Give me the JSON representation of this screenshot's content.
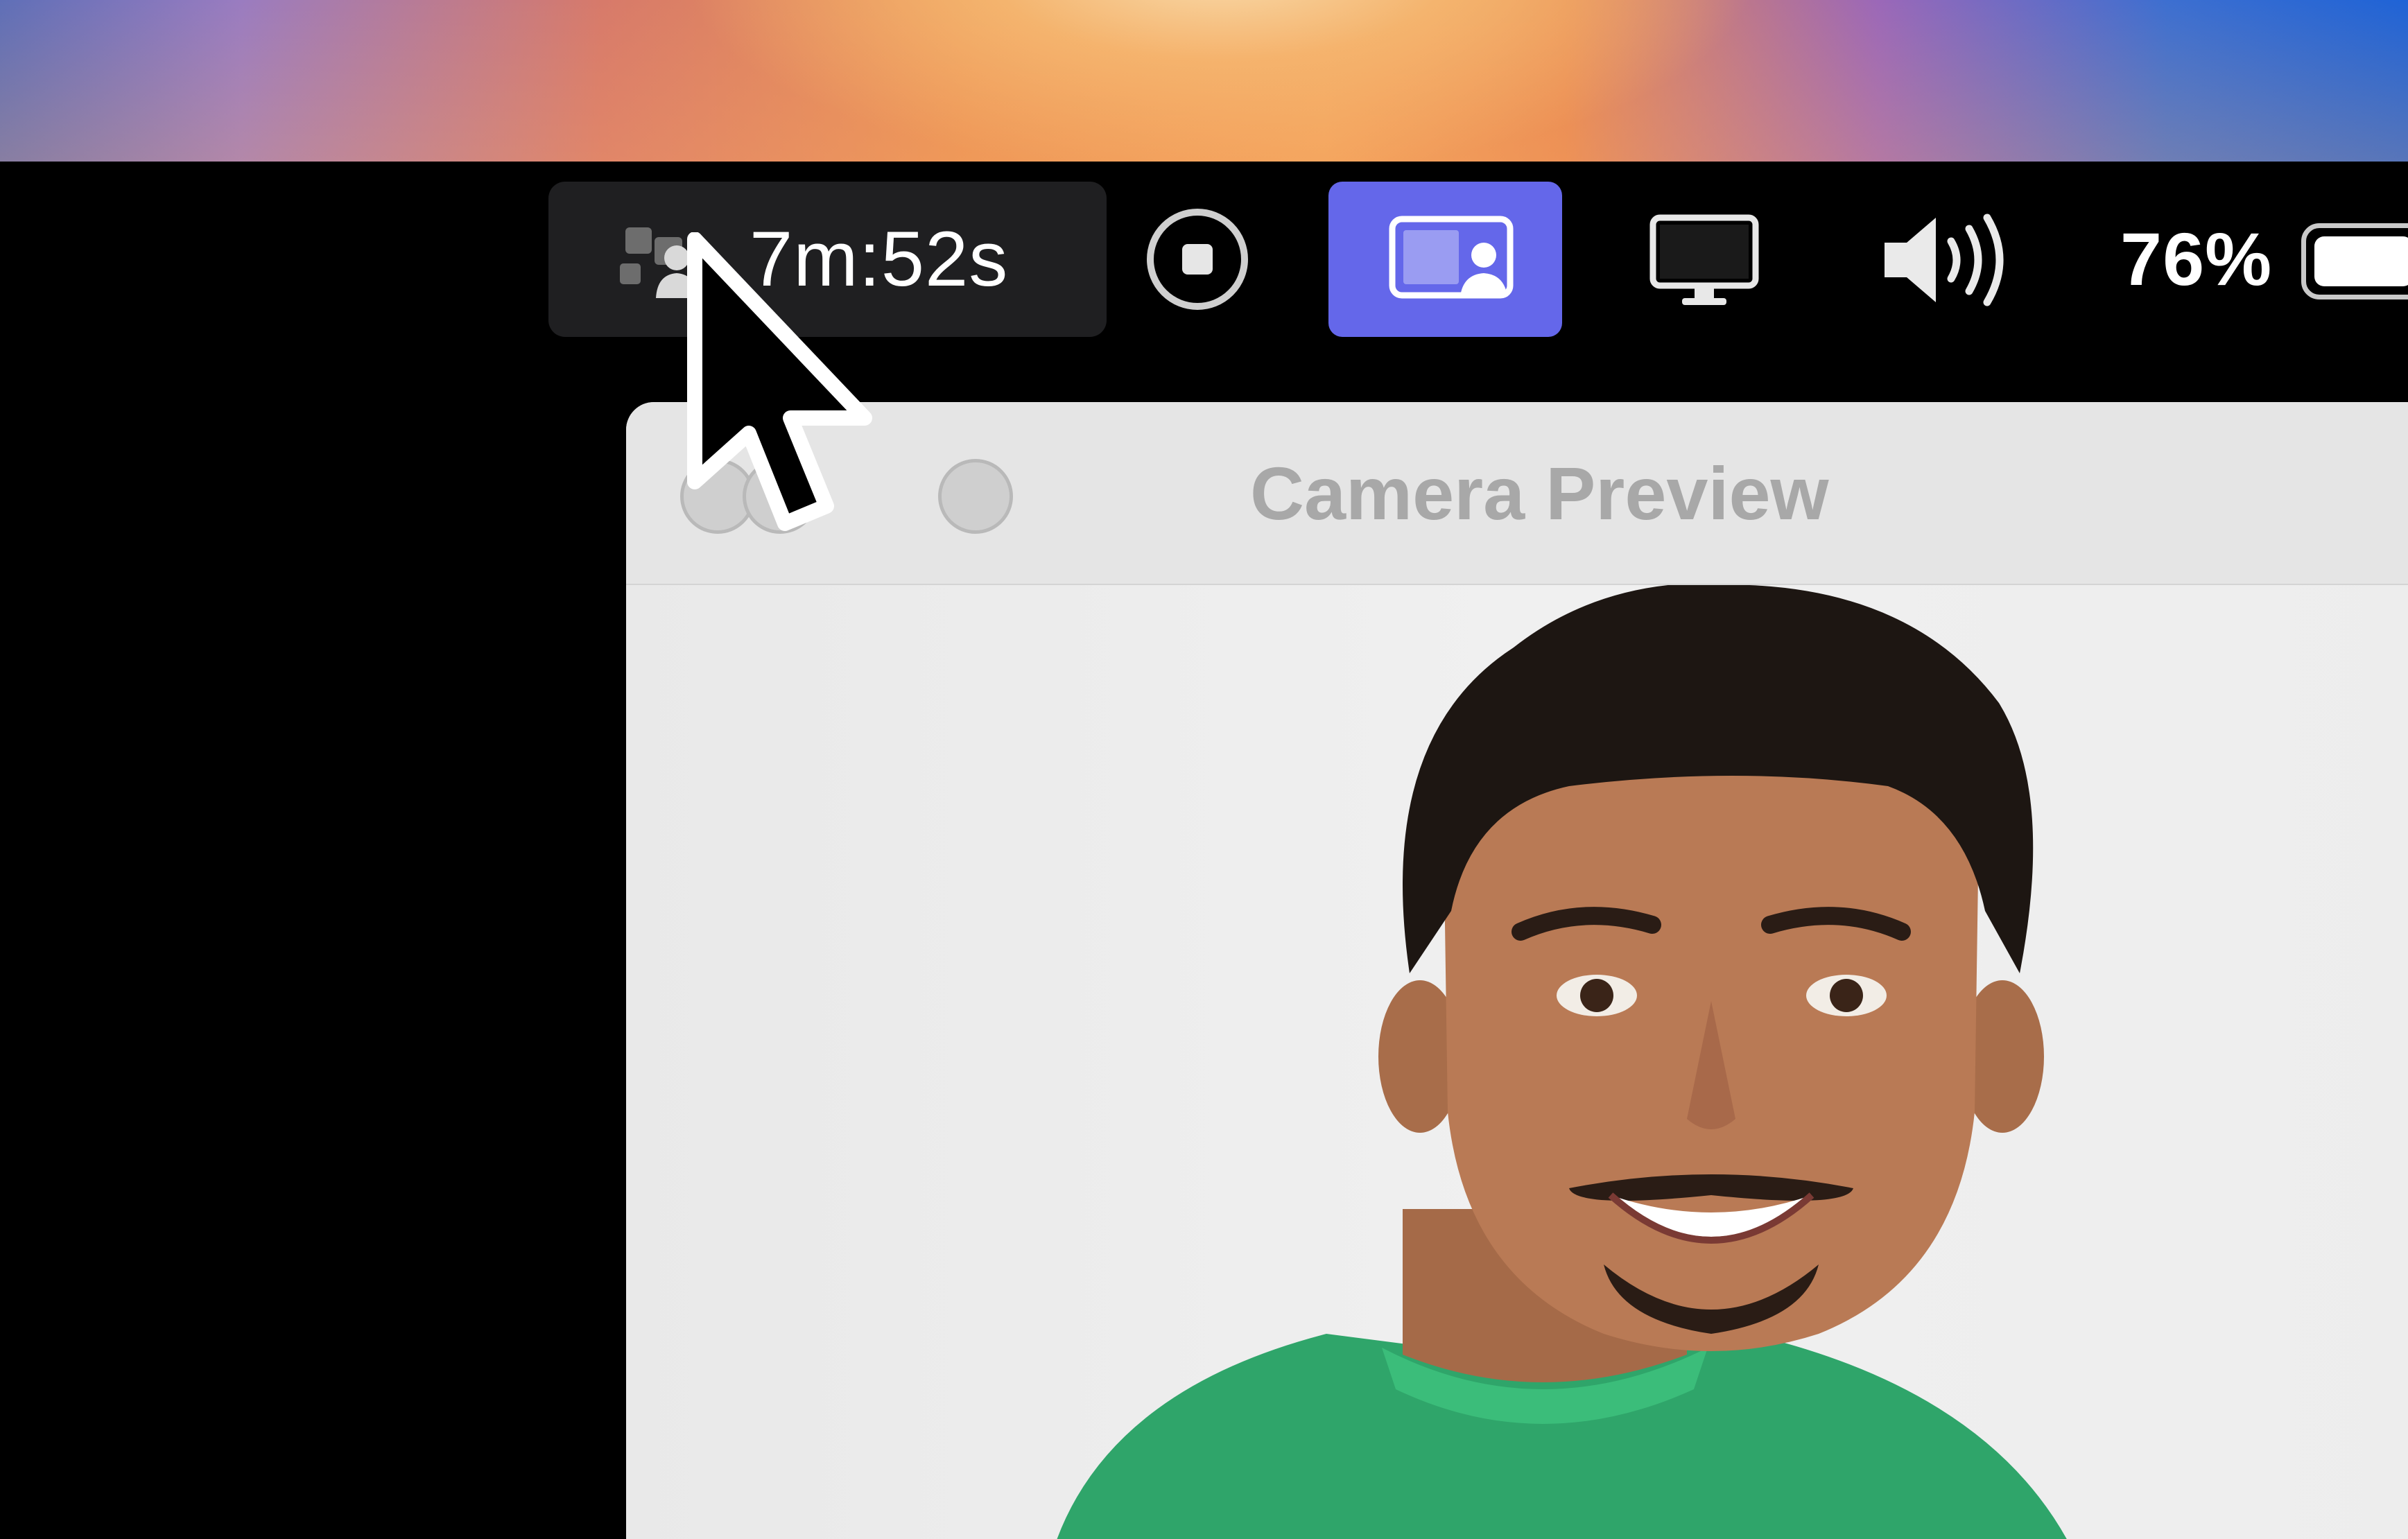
{
  "menubar": {
    "recording": {
      "timer": "7m:52s",
      "icon": "camera-screen-share-icon"
    },
    "stop_icon": "stop-recording-icon",
    "screen_camera_icon": "screen-with-camera-icon",
    "display_icon": "display-icon",
    "volume_icon": "speaker-volume-icon",
    "battery": {
      "percent": "76%",
      "level": 0.76
    }
  },
  "window": {
    "title": "Camera Preview",
    "traffic_lights": [
      "close",
      "minimize",
      "zoom"
    ]
  },
  "colors": {
    "accent": "#6467ea",
    "pill_bg": "#1f1f21",
    "titlebar_bg": "#e5e5e5"
  }
}
